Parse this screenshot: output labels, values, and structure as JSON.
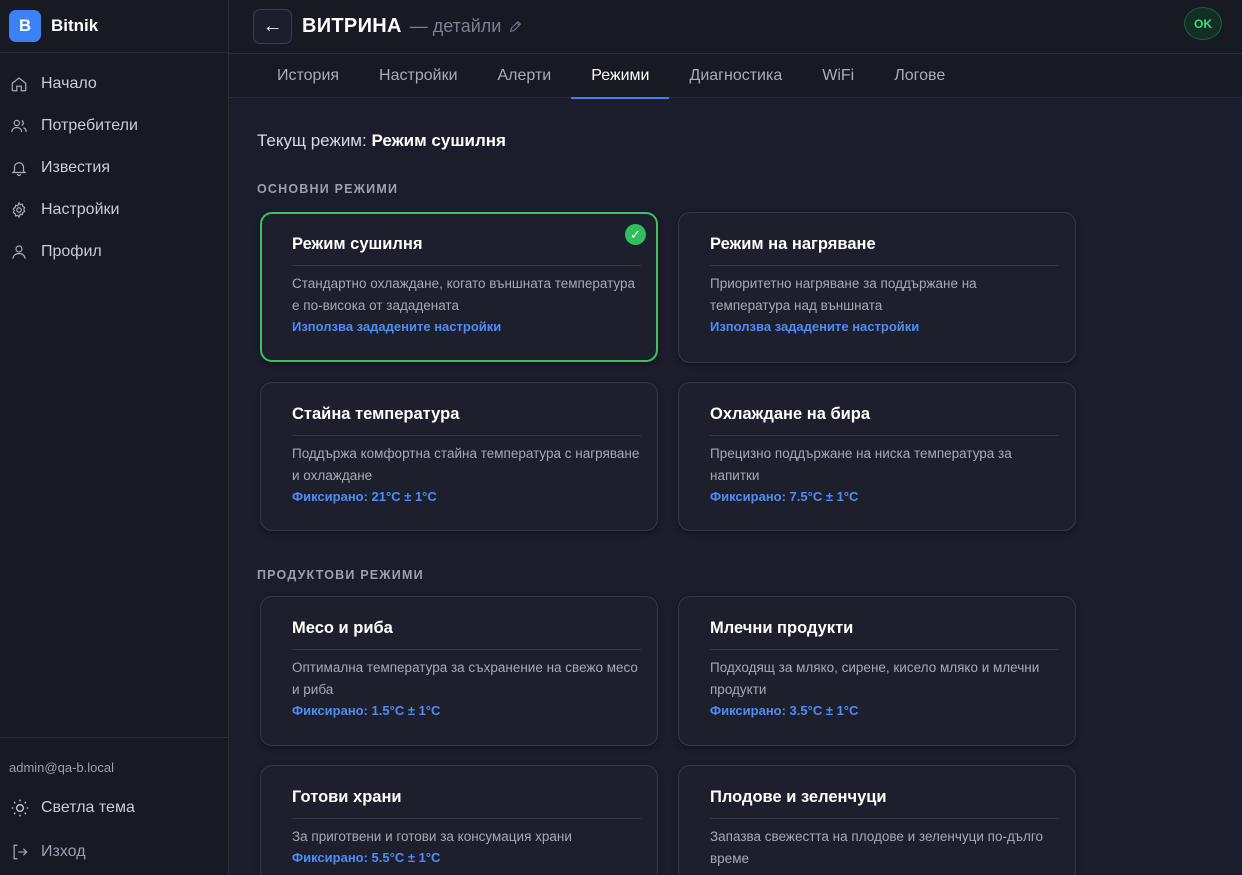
{
  "brand": {
    "logo_letter": "B",
    "name": "Bitnik"
  },
  "sidebar": {
    "items": [
      {
        "label": "Начало",
        "icon": "home-icon"
      },
      {
        "label": "Потребители",
        "icon": "users-icon"
      },
      {
        "label": "Известия",
        "icon": "bell-icon"
      },
      {
        "label": "Настройки",
        "icon": "gear-icon"
      },
      {
        "label": "Профил",
        "icon": "user-icon"
      }
    ],
    "user_email": "admin@qa-b.local",
    "theme_label": "Светла тема",
    "logout_label": "Изход"
  },
  "header": {
    "back_symbol": "←",
    "title": "ВИТРИНА",
    "subtitle": "— детайли",
    "status": "OK"
  },
  "tabs": [
    "История",
    "Настройки",
    "Алерти",
    "Режими",
    "Диагностика",
    "WiFi",
    "Логове"
  ],
  "active_tab": "Режими",
  "main": {
    "current_label": "Текущ режим:",
    "current_value": "Режим сушилня",
    "basic_section": "ОСНОВНИ РЕЖИМИ",
    "product_section": "ПРОДУКТОВИ РЕЖИМИ",
    "basic_modes": [
      {
        "title": "Режим сушилня",
        "desc": "Стандартно охлаждане, когато външната температура е по-висока от зададената",
        "meta": "Използва зададените настройки",
        "selected": true
      },
      {
        "title": "Режим на нагряване",
        "desc": "Приоритетно нагряване за поддържане на температура над външната",
        "meta": "Използва зададените настройки",
        "selected": false
      },
      {
        "title": "Стайна температура",
        "desc": "Поддържа комфортна стайна температура с нагряване и охлаждане",
        "meta": "Фиксирано: 21°C ± 1°C",
        "selected": false
      },
      {
        "title": "Охлаждане на бира",
        "desc": "Прецизно поддържане на ниска температура за напитки",
        "meta": "Фиксирано: 7.5°C ± 1°C",
        "selected": false
      }
    ],
    "product_modes": [
      {
        "title": "Месо и риба",
        "desc": "Оптимална температура за съхранение на свежо месо и риба",
        "meta": "Фиксирано: 1.5°C ± 1°C"
      },
      {
        "title": "Млечни продукти",
        "desc": "Подходящ за мляко, сирене, кисело мляко и млечни продукти",
        "meta": "Фиксирано: 3.5°C ± 1°C"
      },
      {
        "title": "Готови храни",
        "desc": "За приготвени и готови за консумация храни",
        "meta": "Фиксирано: 5.5°C ± 1°C"
      },
      {
        "title": "Плодове и зеленчуци",
        "desc": "Запазва свежестта на плодове и зеленчуци по-дълго време",
        "meta": ""
      }
    ]
  }
}
